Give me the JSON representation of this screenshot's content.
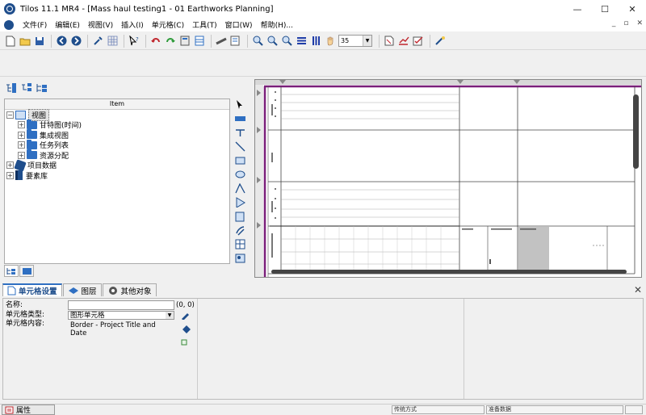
{
  "window": {
    "title": "Tilos 11.1 MR4  - [Mass haul testing1 - 01 Earthworks Planning]",
    "minimize": "—",
    "maximize": "☐",
    "close": "✕"
  },
  "menu": {
    "items": [
      "文件(F)",
      "编辑(E)",
      "视图(V)",
      "插入(I)",
      "单元格(C)",
      "工具(T)",
      "窗口(W)",
      "帮助(H)..."
    ],
    "mdi_minimize": "_",
    "mdi_restore": "▫",
    "mdi_close": "✕"
  },
  "toolbar": {
    "zoom_value": "35",
    "icons": [
      "new-document-icon",
      "open-folder-icon",
      "save-icon",
      "back-icon",
      "forward-icon",
      "tools-icon",
      "grid-icon",
      "pointer-help-icon",
      "undo-icon",
      "redo-icon",
      "calculator-icon",
      "table-icon",
      "ruler-icon",
      "layout-icon",
      "zoom-in-icon",
      "zoom-out-icon",
      "zoom-fit-icon",
      "horizontal-bars-icon",
      "vertical-bars-icon",
      "hand-icon",
      "page-icon",
      "chart-edit-icon",
      "check-edit-icon",
      "wizard-icon"
    ]
  },
  "tree": {
    "header": "Item",
    "root": "视图",
    "children": [
      "甘特图(时间)",
      "集成视图",
      "任务列表",
      "资源分配"
    ],
    "project_data": "项目数据",
    "element_library": "要素库"
  },
  "properties": {
    "tabs": [
      "单元格设置",
      "图层",
      "其他对象"
    ],
    "name_label": "名称:",
    "name_value": "",
    "cell_type_label": "单元格类型:",
    "cell_type_value": "图形单元格",
    "cell_content_label": "单元格内容:",
    "cell_content_value": "Border - Project Title and Date",
    "coords": "(0, 0)"
  },
  "status": {
    "properties_button": "属性",
    "field1": "传统方式",
    "field2": "准备数据"
  }
}
